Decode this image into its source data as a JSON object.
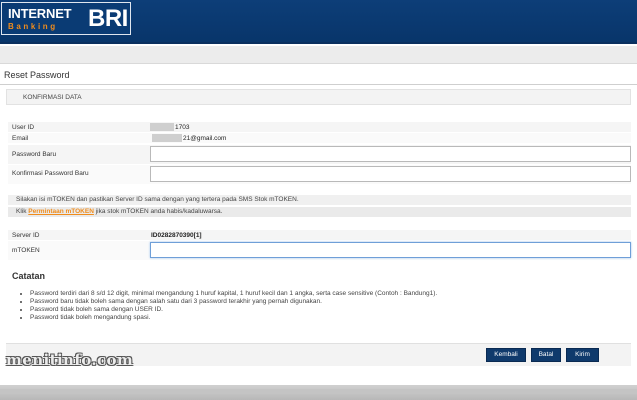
{
  "header": {
    "logo_internet": "INTERNET",
    "logo_banking": "Banking",
    "logo_bri": "BRI"
  },
  "page": {
    "title": "Reset Password",
    "section_title": "KONFIRMASI DATA"
  },
  "form": {
    "user_id_label": "User ID",
    "user_id_value": "1703",
    "email_label": "Email",
    "email_value": "21@gmail.com",
    "new_password_label": "Password Baru",
    "new_password_value": "",
    "confirm_password_label": "Konfirmasi Password Baru",
    "confirm_password_value": "",
    "server_id_label": "Server ID",
    "server_id_value": "ID0282870390[1]",
    "mtoken_label": "mTOKEN",
    "mtoken_value": ""
  },
  "info": {
    "line1": "Silakan isi mTOKEN dan pastikan Server ID sama dengan yang tertera pada SMS Stok mTOKEN.",
    "line2_prefix": "Klik ",
    "line2_link": "Permintaan mTOKEN",
    "line2_suffix": " jika stok mTOKEN anda habis/kadaluwarsa."
  },
  "catatan": {
    "title": "Catatan",
    "items": [
      "Password terdiri dari 8 s/d 12 digit, minimal mengandung 1 huruf kapital, 1 huruf kecil dan 1 angka, serta case sensitive (Contoh : Bandung1).",
      "Password baru tidak boleh sama dengan salah satu dari 3 password terakhir yang pernah digunakan.",
      "Password tidak boleh sama dengan USER ID.",
      "Password tidak boleh mengandung spasi."
    ]
  },
  "buttons": {
    "back": "Kembali",
    "cancel": "Batal",
    "submit": "Kirim"
  },
  "watermark": "menitinfo.com",
  "colors": {
    "header_blue": "#0d3e78",
    "accent_orange": "#f08c1c",
    "button_blue": "#0f3a6c"
  }
}
